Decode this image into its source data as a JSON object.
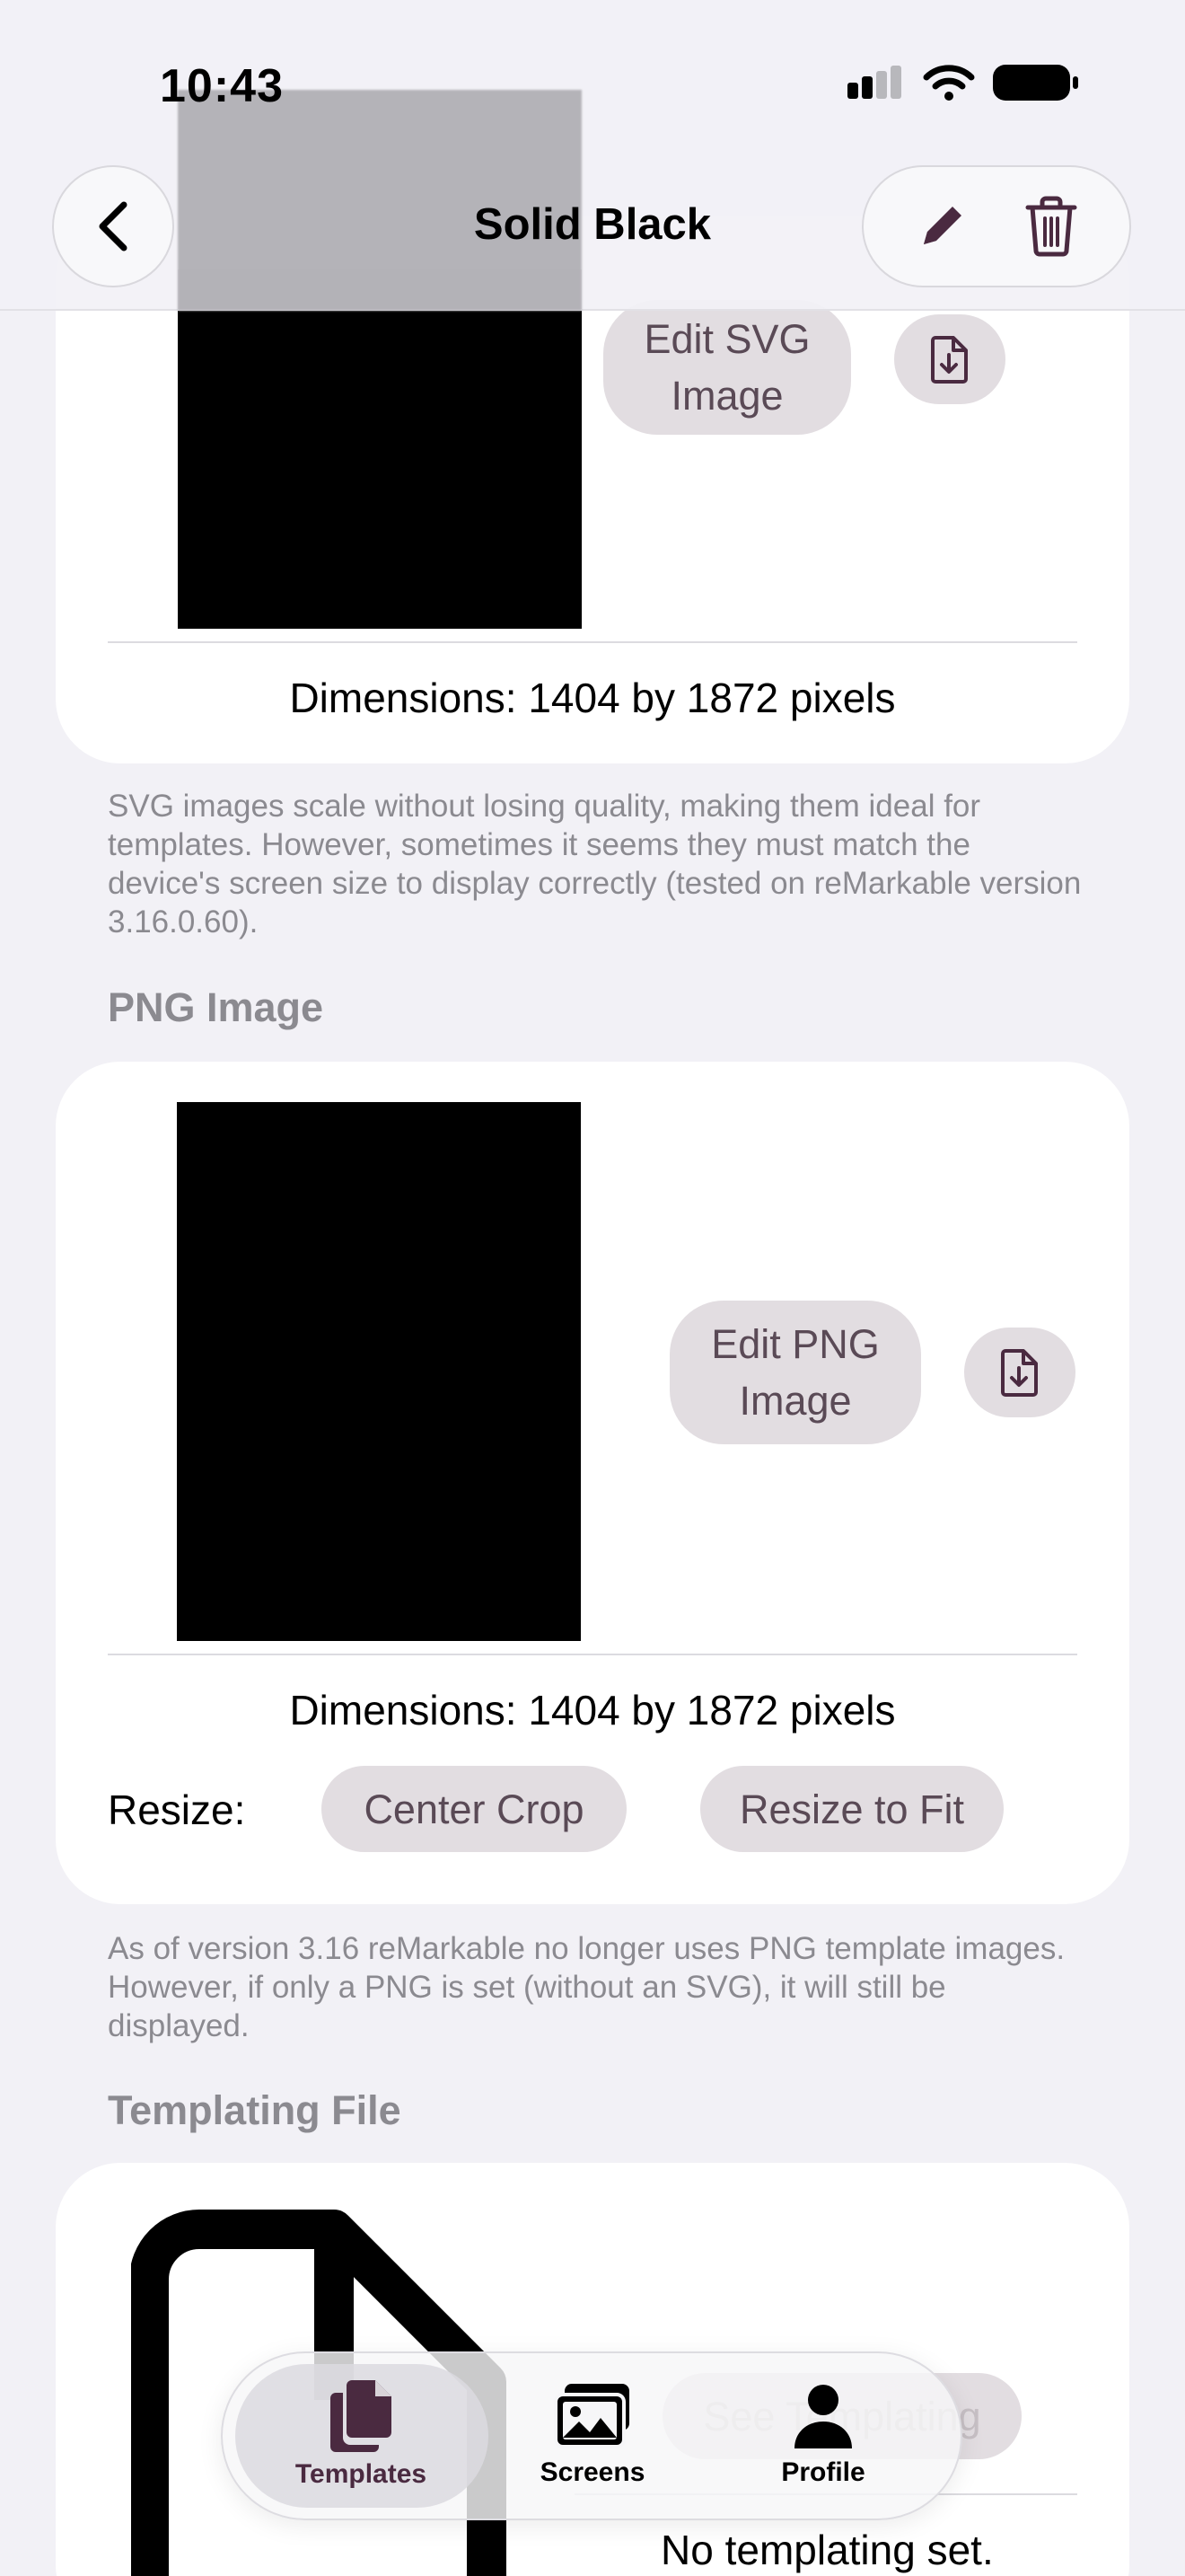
{
  "status_bar": {
    "time": "10:43"
  },
  "nav": {
    "title": "Solid Black"
  },
  "svg_section": {
    "edit_button": "Edit SVG\nImage",
    "dimensions": "Dimensions: 1404 by 1872 pixels",
    "note": "SVG images scale without losing quality, making them ideal for templates. However, sometimes it seems they must match the device's screen size to display correctly (tested on reMarkable version 3.16.0.60)."
  },
  "png_section": {
    "header": "PNG Image",
    "edit_button": "Edit PNG\nImage",
    "dimensions": "Dimensions: 1404 by 1872 pixels",
    "resize_label": "Resize:",
    "resize_options": [
      "Center Crop",
      "Resize to Fit"
    ],
    "note": "As of version 3.16 reMarkable no longer uses PNG template images. However, if only a PNG is set (without an SVG), it will still be displayed."
  },
  "templating_section": {
    "header": "Templating File",
    "see_button": "See Templating",
    "empty_text": "No templating set."
  },
  "tab_bar": {
    "tabs": [
      {
        "label": "Templates",
        "icon": "documents-icon",
        "selected": true
      },
      {
        "label": "Screens",
        "icon": "photos-icon",
        "selected": false
      },
      {
        "label": "Profile",
        "icon": "person-icon",
        "selected": false
      }
    ]
  },
  "colors": {
    "accent": "#4a2a40",
    "pill_bg": "#e2dde1",
    "pill_text": "#5a4a56",
    "background": "#f2f1f6"
  }
}
